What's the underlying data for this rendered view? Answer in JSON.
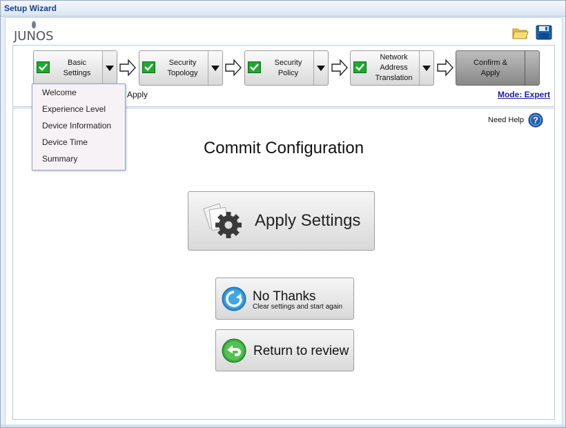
{
  "window": {
    "title": "Setup Wizard"
  },
  "logo": {
    "text": "JUNOS"
  },
  "toolbar": {
    "open_icon": "folder-open-icon",
    "save_icon": "floppy-save-icon"
  },
  "steps": [
    {
      "label_line1": "Basic",
      "label_line2": "Settings",
      "complete": true
    },
    {
      "label_line1": "Security",
      "label_line2": "Topology",
      "complete": true
    },
    {
      "label_line1": "Security",
      "label_line2": "Policy",
      "complete": true
    },
    {
      "label_line1": "Network",
      "label_line2": "Address",
      "label_line3": "Translation",
      "complete": true
    },
    {
      "label_line1": "Confirm &",
      "label_line2": "Apply",
      "complete": false
    }
  ],
  "step_subtext": "Apply",
  "mode_link": "Mode: Expert",
  "help": {
    "label": "Need Help"
  },
  "main": {
    "heading": "Commit Configuration",
    "apply_button": "Apply Settings",
    "no_thanks_title": "No Thanks",
    "no_thanks_sub": "Clear settings and start again",
    "return_button": "Return to review"
  },
  "dropdown_menu": {
    "items": [
      "Welcome",
      "Experience Level",
      "Device Information",
      "Device Time",
      "Summary"
    ]
  },
  "colors": {
    "title_text": "#15428b",
    "link": "#1a1aa6",
    "check_green": "#1fa92e"
  }
}
